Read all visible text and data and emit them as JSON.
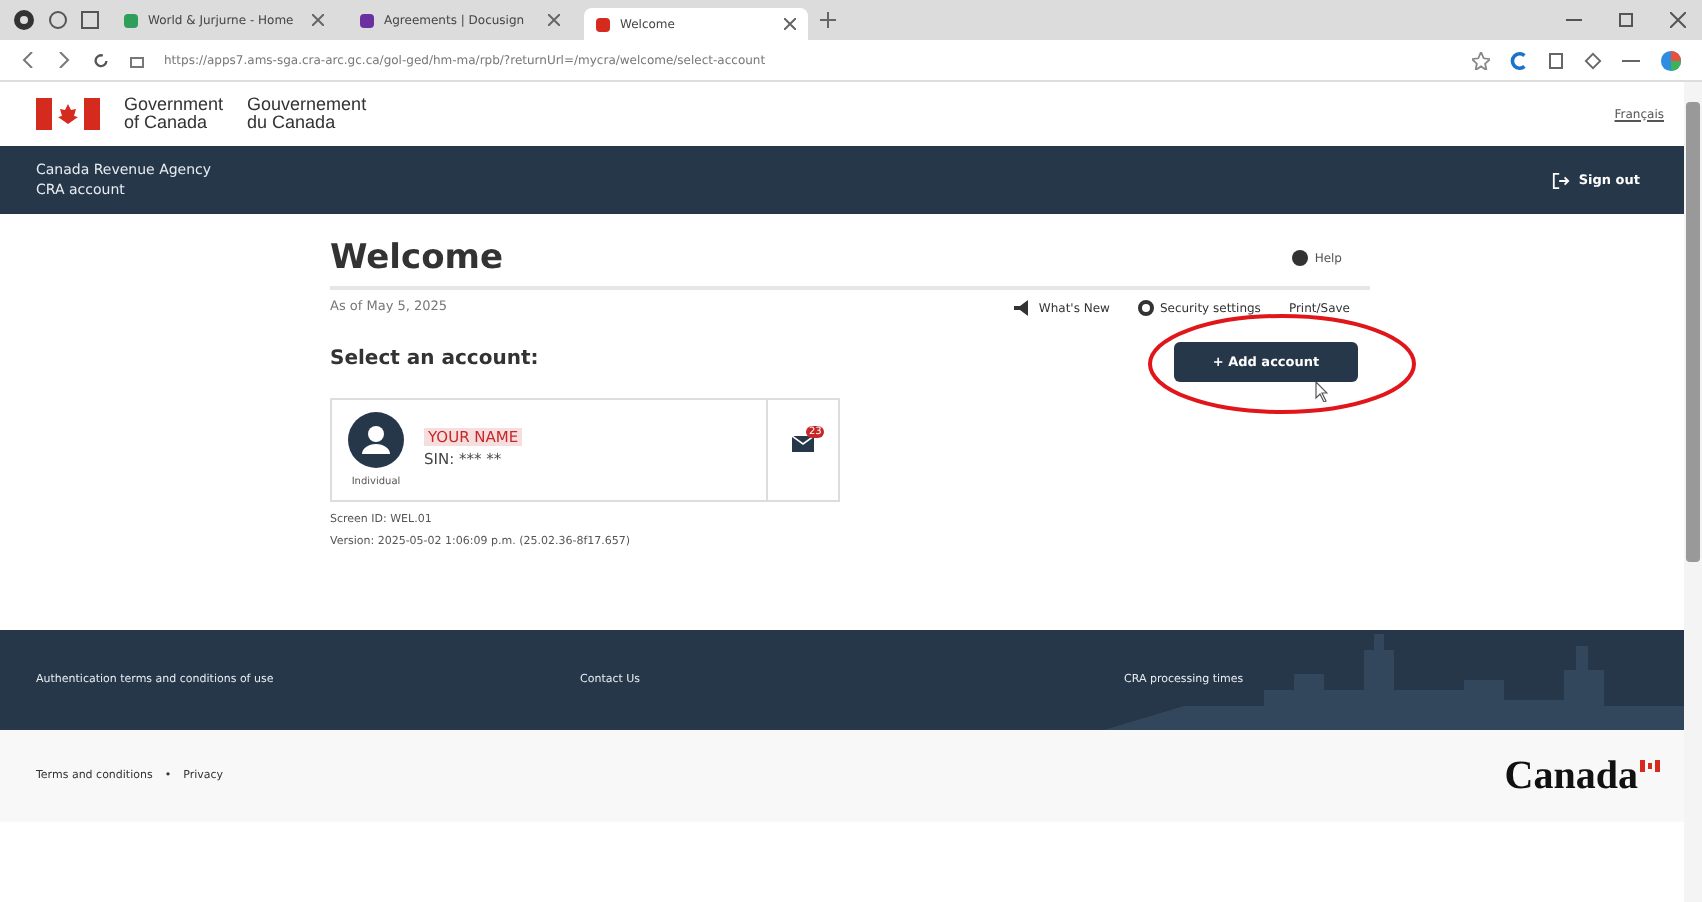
{
  "browser": {
    "tabs": [
      {
        "title": "World & Jurjurne - Home",
        "selected": false,
        "color": "#2e9e5b"
      },
      {
        "title": "Agreements | Docusign",
        "selected": false,
        "color": "#6b2fa0"
      },
      {
        "title": "Welcome",
        "selected": true,
        "color": "#d52b1e"
      }
    ],
    "url": "https://apps7.ams-sga.cra-arc.gc.ca/gol-ged/hm-ma/rpb/?returnUrl=/mycra/welcome/select-account"
  },
  "header": {
    "gov_en": [
      "Government",
      "of Canada"
    ],
    "gov_fr": [
      "Gouvernement",
      "du Canada"
    ],
    "language_link": "Français"
  },
  "band": {
    "agency": "Canada Revenue Agency",
    "account": "CRA account",
    "sign_out": "Sign out"
  },
  "page": {
    "title": "Welcome",
    "help": "Help",
    "as_of": "As of May 5, 2025",
    "links": [
      {
        "kind": "news",
        "label": "What's New"
      },
      {
        "kind": "settings",
        "label": "Security settings"
      },
      {
        "kind": "plain",
        "label": "Print/Save"
      }
    ],
    "section_title": "Select an account:",
    "add_button": "+ Add account",
    "accounts": [
      {
        "name": "YOUR NAME",
        "sin": "SIN: *** **",
        "type": "Individual",
        "badge": "23"
      }
    ],
    "screen_id": "Screen ID: WEL.01",
    "version": "Version: 2025-05-02 1:06:09 p.m. (25.02.36-8f17.657)"
  },
  "footer": {
    "links": [
      "Authentication terms and conditions of use",
      "Contact Us",
      "CRA processing times"
    ]
  },
  "subfooter": {
    "links": [
      "Terms and conditions",
      "Privacy"
    ],
    "separator": "•",
    "wordmark": "Canada"
  }
}
